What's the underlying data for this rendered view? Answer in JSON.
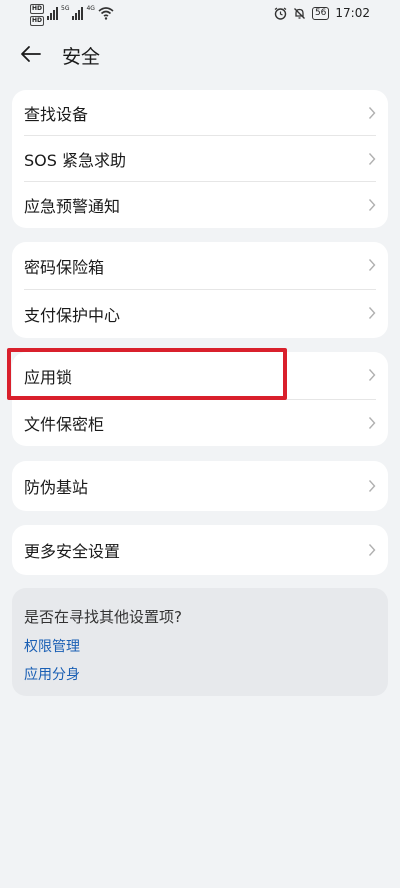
{
  "status_bar": {
    "hd1": "HD",
    "hd2": "HD",
    "net1": "5G",
    "net2": "4G",
    "battery": "56",
    "time": "17:02"
  },
  "header": {
    "title": "安全"
  },
  "groups": [
    {
      "items": [
        {
          "label": "查找设备"
        },
        {
          "label": "SOS 紧急求助"
        },
        {
          "label": "应急预警通知"
        }
      ]
    },
    {
      "items": [
        {
          "label": "密码保险箱"
        },
        {
          "label": "支付保护中心"
        }
      ]
    },
    {
      "items": [
        {
          "label": "应用锁"
        },
        {
          "label": "文件保密柜"
        }
      ]
    },
    {
      "items": [
        {
          "label": "防伪基站"
        }
      ]
    },
    {
      "items": [
        {
          "label": "更多安全设置"
        }
      ]
    }
  ],
  "suggestions": {
    "title": "是否在寻找其他设置项?",
    "links": [
      "权限管理",
      "应用分身"
    ]
  },
  "colors": {
    "background": "#f1f3f5",
    "card": "#ffffff",
    "link": "#1a5fb4",
    "highlight": "#d9202c"
  }
}
